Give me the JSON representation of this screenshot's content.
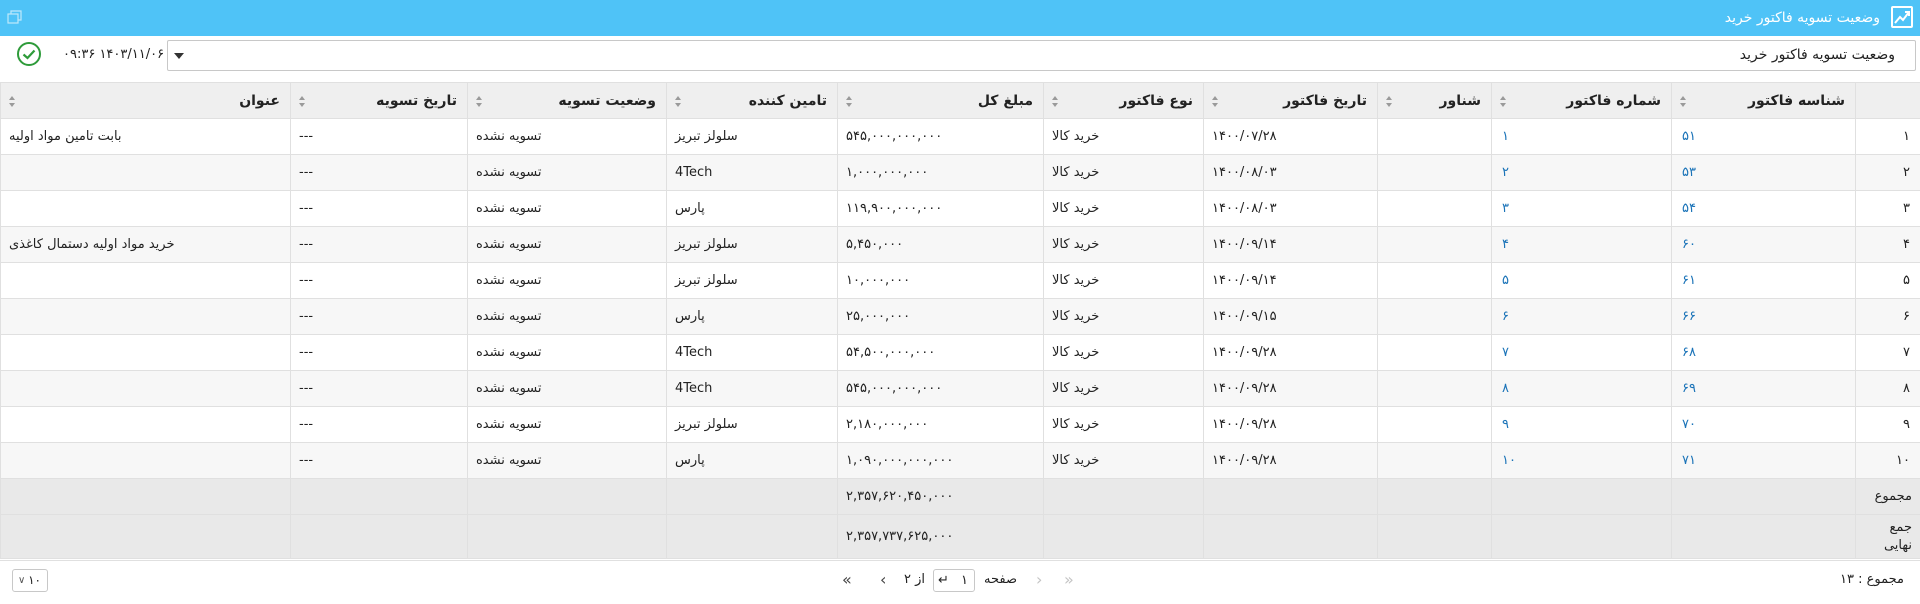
{
  "window": {
    "title": "وضعیت تسویه فاکتور خرید"
  },
  "toolbar": {
    "select_value": "وضعیت تسویه فاکتور خرید",
    "datetime": "۱۴۰۳/۱۱/۰۶ ۰۹:۳۶"
  },
  "grid": {
    "columns": [
      "شناسه فاکتور",
      "شماره فاکتور",
      "شناور",
      "تاریخ فاکتور",
      "نوع فاکتور",
      "مبلغ کل",
      "تامین کننده",
      "وضعیت تسویه",
      "تاریخ تسویه",
      "عنوان"
    ],
    "rows": [
      {
        "num": "۱",
        "id": "۵۱",
        "no": "۱",
        "float": "",
        "date": "۱۴۰۰/۰۷/۲۸",
        "type": "خرید کالا",
        "amount": "۵۴۵,۰۰۰,۰۰۰,۰۰۰",
        "supplier": "سلولز تبریز",
        "status": "تسویه نشده",
        "settle_date": "---",
        "title": "بابت تامین مواد اولیه"
      },
      {
        "num": "۲",
        "id": "۵۳",
        "no": "۲",
        "float": "",
        "date": "۱۴۰۰/۰۸/۰۳",
        "type": "خرید کالا",
        "amount": "۱,۰۰۰,۰۰۰,۰۰۰",
        "supplier": "4Tech",
        "status": "تسویه نشده",
        "settle_date": "---",
        "title": ""
      },
      {
        "num": "۳",
        "id": "۵۴",
        "no": "۳",
        "float": "",
        "date": "۱۴۰۰/۰۸/۰۳",
        "type": "خرید کالا",
        "amount": "۱۱۹,۹۰۰,۰۰۰,۰۰۰",
        "supplier": "پارس",
        "status": "تسویه نشده",
        "settle_date": "---",
        "title": ""
      },
      {
        "num": "۴",
        "id": "۶۰",
        "no": "۴",
        "float": "",
        "date": "۱۴۰۰/۰۹/۱۴",
        "type": "خرید کالا",
        "amount": "۵,۴۵۰,۰۰۰",
        "supplier": "سلولز تبریز",
        "status": "تسویه نشده",
        "settle_date": "---",
        "title": "خرید مواد اولیه دستمال کاغذی"
      },
      {
        "num": "۵",
        "id": "۶۱",
        "no": "۵",
        "float": "",
        "date": "۱۴۰۰/۰۹/۱۴",
        "type": "خرید کالا",
        "amount": "۱۰,۰۰۰,۰۰۰",
        "supplier": "سلولز تبریز",
        "status": "تسویه نشده",
        "settle_date": "---",
        "title": ""
      },
      {
        "num": "۶",
        "id": "۶۶",
        "no": "۶",
        "float": "",
        "date": "۱۴۰۰/۰۹/۱۵",
        "type": "خرید کالا",
        "amount": "۲۵,۰۰۰,۰۰۰",
        "supplier": "پارس",
        "status": "تسویه نشده",
        "settle_date": "---",
        "title": ""
      },
      {
        "num": "۷",
        "id": "۶۸",
        "no": "۷",
        "float": "",
        "date": "۱۴۰۰/۰۹/۲۸",
        "type": "خرید کالا",
        "amount": "۵۴,۵۰۰,۰۰۰,۰۰۰",
        "supplier": "4Tech",
        "status": "تسویه نشده",
        "settle_date": "---",
        "title": ""
      },
      {
        "num": "۸",
        "id": "۶۹",
        "no": "۸",
        "float": "",
        "date": "۱۴۰۰/۰۹/۲۸",
        "type": "خرید کالا",
        "amount": "۵۴۵,۰۰۰,۰۰۰,۰۰۰",
        "supplier": "4Tech",
        "status": "تسویه نشده",
        "settle_date": "---",
        "title": ""
      },
      {
        "num": "۹",
        "id": "۷۰",
        "no": "۹",
        "float": "",
        "date": "۱۴۰۰/۰۹/۲۸",
        "type": "خرید کالا",
        "amount": "۲,۱۸۰,۰۰۰,۰۰۰",
        "supplier": "سلولز تبریز",
        "status": "تسویه نشده",
        "settle_date": "---",
        "title": ""
      },
      {
        "num": "۱۰",
        "id": "۷۱",
        "no": "۱۰",
        "float": "",
        "date": "۱۴۰۰/۰۹/۲۸",
        "type": "خرید کالا",
        "amount": "۱,۰۹۰,۰۰۰,۰۰۰,۰۰۰",
        "supplier": "پارس",
        "status": "تسویه نشده",
        "settle_date": "---",
        "title": ""
      }
    ],
    "footer": {
      "sum_label": "مجموع",
      "sum_value": "۲,۳۵۷,۶۲۰,۴۵۰,۰۰۰",
      "final_label": "جمع نهایی",
      "final_value": "۲,۳۵۷,۷۳۷,۶۲۵,۰۰۰"
    }
  },
  "pager": {
    "total_text": "مجموع : ۱۳",
    "page_label": "صفحه",
    "page_value": "۱",
    "of_text": "از ۲",
    "page_size": "۱۰"
  },
  "colors": {
    "header_bar": "#4fc3f7",
    "link": "#1a73b8",
    "check": "#2e9b3a"
  },
  "icons": [
    "chart-icon",
    "restore-icon",
    "check-circle-icon",
    "sort-icon",
    "first-page-icon",
    "prev-page-icon",
    "next-page-icon",
    "last-page-icon",
    "enter-icon",
    "chevron-down-icon"
  ]
}
